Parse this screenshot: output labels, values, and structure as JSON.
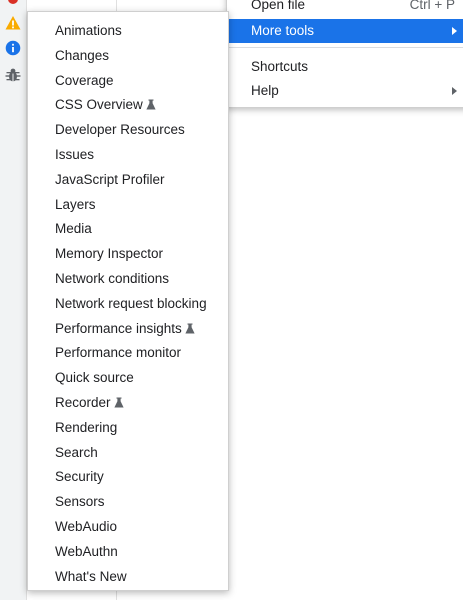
{
  "parent_menu": {
    "items": [
      {
        "label": "Open file",
        "shortcut": "Ctrl + P"
      },
      {
        "label": "More tools",
        "submenu": true
      },
      {
        "label": "Shortcuts"
      },
      {
        "label": "Help",
        "submenu": true
      }
    ]
  },
  "submenu": {
    "items": [
      {
        "label": "Animations"
      },
      {
        "label": "Changes"
      },
      {
        "label": "Coverage"
      },
      {
        "label": "CSS Overview",
        "experimental": true
      },
      {
        "label": "Developer Resources"
      },
      {
        "label": "Issues"
      },
      {
        "label": "JavaScript Profiler"
      },
      {
        "label": "Layers"
      },
      {
        "label": "Media"
      },
      {
        "label": "Memory Inspector"
      },
      {
        "label": "Network conditions"
      },
      {
        "label": "Network request blocking"
      },
      {
        "label": "Performance insights",
        "experimental": true
      },
      {
        "label": "Performance monitor"
      },
      {
        "label": "Quick source"
      },
      {
        "label": "Recorder",
        "experimental": true
      },
      {
        "label": "Rendering"
      },
      {
        "label": "Search"
      },
      {
        "label": "Security"
      },
      {
        "label": "Sensors"
      },
      {
        "label": "WebAudio"
      },
      {
        "label": "WebAuthn"
      },
      {
        "label": "What's New"
      }
    ]
  },
  "sidebar_icons": [
    "error-icon",
    "warning-icon",
    "info-icon",
    "bug-icon"
  ],
  "colors": {
    "highlight": "#1a73e8",
    "warning": "#f9ab00",
    "info": "#1a73e8",
    "error": "#d93025",
    "bug": "#5f6368"
  }
}
